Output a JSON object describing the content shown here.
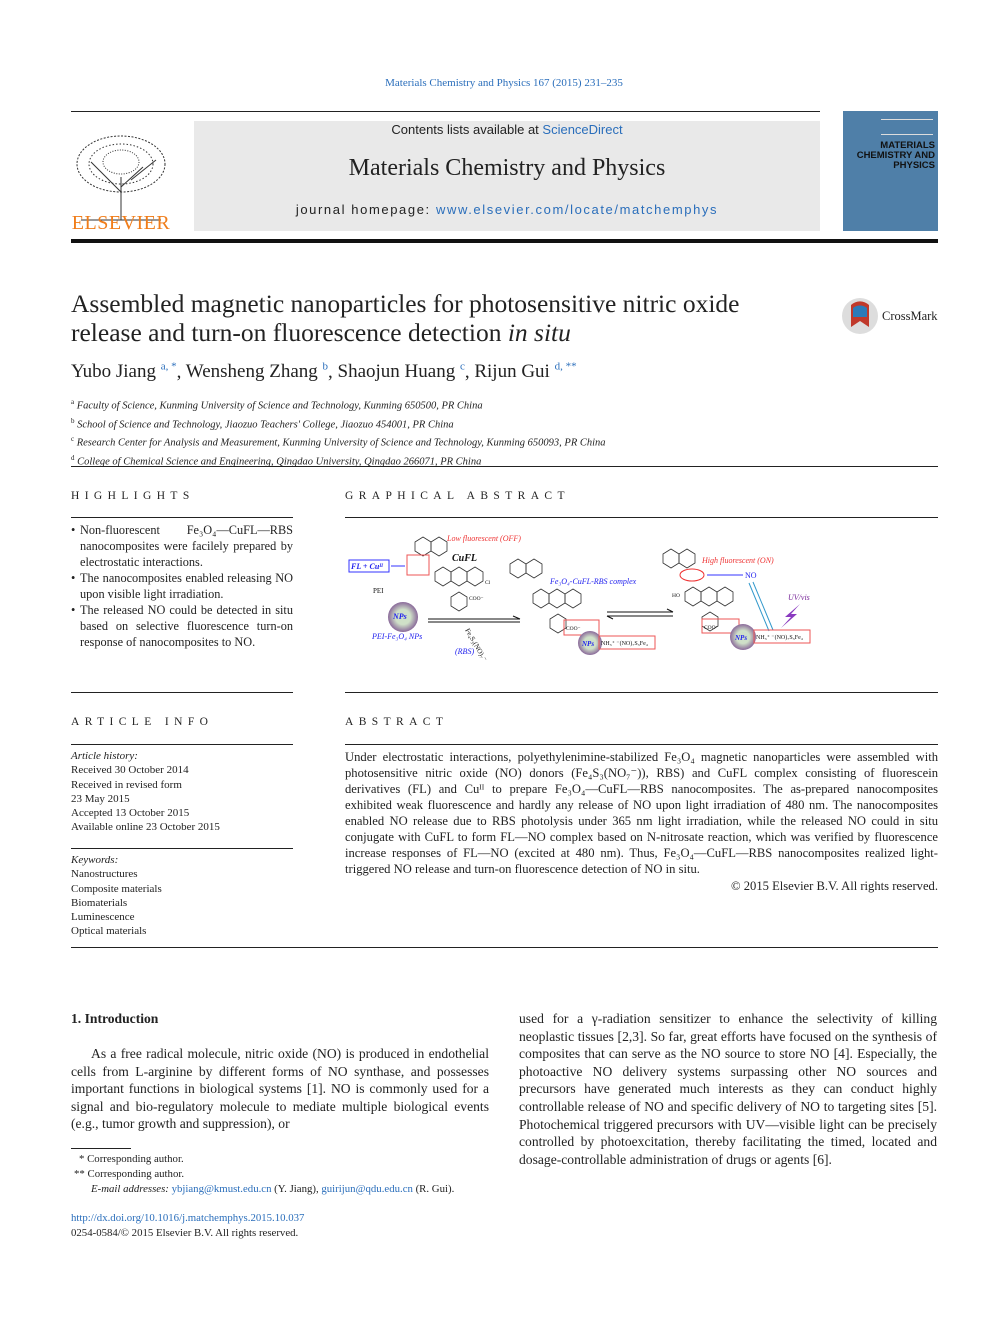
{
  "header": {
    "journal_ref": "Materials Chemistry and Physics 167 (2015) 231–235",
    "contents_prefix": "Contents lists available at ",
    "sciencedirect": "ScienceDirect",
    "journal_name": "Materials Chemistry and Physics",
    "homepage_prefix": "journal homepage: ",
    "homepage_url": "www.elsevier.com/locate/matchemphys",
    "publisher_logo_text": "ELSEVIER",
    "cover_text": "MATERIALS CHEMISTRY AND PHYSICS",
    "crossmark": "CrossMark"
  },
  "article": {
    "title_part1": "Assembled magnetic nanoparticles for photosensitive nitric oxide release and turn-on fluorescence detection ",
    "title_italic": "in situ",
    "authors": [
      {
        "name": "Yubo Jiang",
        "sup": "a, *"
      },
      {
        "name": "Wensheng Zhang",
        "sup": "b"
      },
      {
        "name": "Shaojun Huang",
        "sup": "c"
      },
      {
        "name": "Rijun Gui",
        "sup": "d, **"
      }
    ],
    "affiliations": [
      {
        "key": "a",
        "text": "Faculty of Science, Kunming University of Science and Technology, Kunming 650500, PR China"
      },
      {
        "key": "b",
        "text": "School of Science and Technology, Jiaozuo Teachers' College, Jiaozuo 454001, PR China"
      },
      {
        "key": "c",
        "text": "Research Center for Analysis and Measurement, Kunming University of Science and Technology, Kunming 650093, PR China"
      },
      {
        "key": "d",
        "text": "College of Chemical Science and Engineering, Qingdao University, Qingdao 266071, PR China"
      }
    ]
  },
  "highlights": {
    "heading": "HIGHLIGHTS",
    "items": [
      "Non-fluorescent Fe₃O₄—CuFL—RBS nanocomposites were facilely prepared by electrostatic interactions.",
      "The nanocomposites enabled releasing NO upon visible light irradiation.",
      "The released NO could be detected in situ based on selective fluorescence turn-on response of nanocomposites to NO."
    ]
  },
  "graphical_abstract": {
    "heading": "GRAPHICAL ABSTRACT",
    "labels": {
      "low": "Low fluorescent (OFF)",
      "cufl": "CuFL",
      "flcu": "FL + Cuᴵᴵ",
      "pei": "PEI",
      "nps": "NPs",
      "nh3": "NH₃⁺",
      "pei_fe3o4": "PEI-Fe₃O₄ NPs",
      "rbs_formula": "Fe₄S₃(NO)₇⁻",
      "rbs": "(RBS)",
      "complex": "Fe₃O₄-CuFL-RBS complex",
      "high": "High fluorescent (ON)",
      "no": "NO",
      "uv": "UV/vis",
      "nh3_rbs": "NH₃⁺ ⁻(NO)₇S₃Fe₄",
      "coo": "COO⁻",
      "cl": "Cl",
      "ho": "HO"
    }
  },
  "article_info": {
    "heading": "ARTICLE INFO",
    "history_label": "Article history:",
    "history": [
      "Received 30 October 2014",
      "Received in revised form",
      "23 May 2015",
      "Accepted 13 October 2015",
      "Available online 23 October 2015"
    ],
    "keywords_label": "Keywords:",
    "keywords": [
      "Nanostructures",
      "Composite materials",
      "Biomaterials",
      "Luminescence",
      "Optical materials"
    ]
  },
  "abstract": {
    "heading": "ABSTRACT",
    "text": "Under electrostatic interactions, polyethylenimine-stabilized Fe₃O₄ magnetic nanoparticles were assembled with photosensitive nitric oxide (NO) donors (Fe₄S₃(NO₇⁻)), RBS) and CuFL complex consisting of fluorescein derivatives (FL) and Cuᴵᴵ to prepare Fe₃O₄—CuFL—RBS nanocomposites. The as-prepared nanocomposites exhibited weak fluorescence and hardly any release of NO upon light irradiation of 480 nm. The nanocomposites enabled NO release due to RBS photolysis under 365 nm light irradiation, while the released NO could in situ conjugate with CuFL to form FL—NO complex based on N-nitrosate reaction, which was verified by fluorescence increase responses of FL—NO (excited at 480 nm). Thus, Fe₃O₄—CuFL—RBS nanocomposites realized light-triggered NO release and turn-on fluorescence detection of NO in situ.",
    "copyright": "© 2015 Elsevier B.V. All rights reserved."
  },
  "intro": {
    "heading": "1.  Introduction",
    "col1": "As a free radical molecule, nitric oxide (NO) is produced in endothelial cells from L-arginine by different forms of NO synthase, and possesses important functions in biological systems [1]. NO is commonly used for a signal and bio-regulatory molecule to mediate multiple biological events (e.g., tumor growth and suppression), or",
    "col2": "used for a γ-radiation sensitizer to enhance the selectivity of killing neoplastic tissues [2,3]. So far, great efforts have focused on the synthesis of composites that can serve as the NO source to store NO [4]. Especially, the photoactive NO delivery systems surpassing other NO sources and precursors have generated much interests as they can conduct highly controllable release of NO and specific delivery of NO to targeting sites [5]. Photochemical triggered precursors with UV—visible light can be precisely controlled by photoexcitation, thereby facilitating the timed, located and dosage-controllable administration of drugs or agents [6]."
  },
  "footnotes": {
    "fn1": "*  Corresponding author.",
    "fn2": "**  Corresponding author.",
    "email_label": "E-mail addresses: ",
    "email1": "ybjiang@kmust.edu.cn",
    "email1_who": " (Y. Jiang), ",
    "email2": "guirijun@qdu.edu.cn",
    "email2_who": " (R. Gui).",
    "doi": "http://dx.doi.org/10.1016/j.matchemphys.2015.10.037",
    "issn": "0254-0584/© 2015 Elsevier B.V. All rights reserved."
  },
  "colors": {
    "link": "#2a6ebb",
    "elsevier_orange": "#f07d1a",
    "header_grey": "#e9e9e9",
    "cover_blue": "#4f7fa8"
  }
}
